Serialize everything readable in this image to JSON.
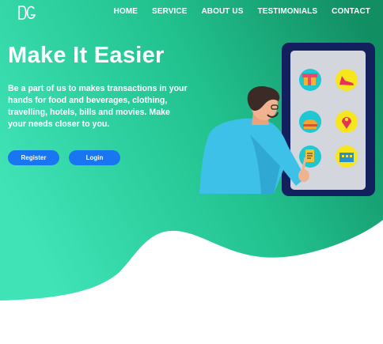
{
  "brand": {
    "logo_text": "DG"
  },
  "nav": {
    "items": [
      {
        "label": "HOME"
      },
      {
        "label": "SERVICE"
      },
      {
        "label": "ABOUT US"
      },
      {
        "label": "TESTIMONIALS"
      },
      {
        "label": "CONTACT"
      }
    ]
  },
  "hero": {
    "title": "Make It Easier",
    "description": "Be a part of us to makes transactions in your hands for food and beverages, clothing, travelling, hotels, bills and movies. Make your needs closer to you.",
    "register_label": "Register",
    "login_label": "Login"
  },
  "colors": {
    "gradient_start": "#3de2b5",
    "gradient_end": "#149a6c",
    "button": "#1a75f0",
    "phone_frame": "#13205e"
  },
  "icons": [
    "gift-icon",
    "shoe-icon",
    "food-icon",
    "location-icon",
    "bill-icon",
    "hotel-icon"
  ]
}
